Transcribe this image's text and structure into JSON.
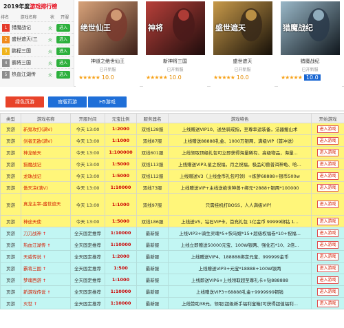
{
  "ranking": {
    "title_year": "2019年度",
    "title_hl": "游戏排行榜",
    "head": [
      "排名",
      "游戏名称",
      "状",
      "开服"
    ],
    "items": [
      {
        "num": "1",
        "name": "猎魔战记",
        "status": "火",
        "btn": "进入",
        "color": "#e53a2a"
      },
      {
        "num": "2",
        "name": "盛世遮天(三",
        "status": "火",
        "btn": "进入",
        "color": "#f08a1c"
      },
      {
        "num": "3",
        "name": "鹏程三国",
        "status": "火",
        "btn": "进入",
        "color": "#f0b41c"
      },
      {
        "num": "4",
        "name": "霸将三国",
        "status": "火",
        "btn": "进入",
        "color": "#8c8c8c"
      },
      {
        "num": "5",
        "name": "热血江湖传",
        "status": "火",
        "btn": "进入",
        "color": "#8c8c8c"
      }
    ]
  },
  "games": [
    {
      "name": "神道之绝世仙王",
      "status": "已开新服",
      "stars": "★★★★★",
      "score": "10.0",
      "active": false,
      "art": "绝世仙王"
    },
    {
      "name": "新神将三国",
      "status": "已开新服",
      "stars": "★★★★★",
      "score": "10.0",
      "active": false,
      "art": "神将"
    },
    {
      "name": "盛世遮天",
      "status": "已开新服",
      "stars": "★★★★★",
      "score": "10.0",
      "active": false,
      "art": "盛世遮天"
    },
    {
      "name": "猎魔战纪",
      "status": "已开新服",
      "stars": "★★★★★",
      "score": "10.0",
      "active": true,
      "art": "猎魔战纪"
    }
  ],
  "tabs": [
    {
      "label": "绿色页游",
      "color": "#e8432a"
    },
    {
      "label": "官版页游",
      "color": "#1f6fd8"
    },
    {
      "label": "H5游戏",
      "color": "#1f6fd8"
    }
  ],
  "table": {
    "headers": [
      "类型",
      "游戏名称",
      "开服时间",
      "元宝比例",
      "服务器名",
      "游戏特色",
      "开始游戏"
    ],
    "rows": [
      {
        "style": "y",
        "type": "页游",
        "name": "新鬼攻打(满V)",
        "hot": false,
        "time": "今天 13:00",
        "ratio": "1:2000",
        "server": "双线128服",
        "feature": "上线赠送VIP10、送坐骑戒指，至尊幸运装备，法器搬山术",
        "btn": "进入游戏"
      },
      {
        "style": "y",
        "type": "页游",
        "name": "剑者无敌(满V)",
        "hot": false,
        "time": "今天 13:00",
        "ratio": "1:1000",
        "server": "双线87服",
        "feature": "上线赠送88888礼金、1000万银两，满级VIP（首冲送）",
        "btn": "进入游戏"
      },
      {
        "style": "y",
        "type": "页游",
        "name": "神龙破天",
        "hot": false,
        "time": "今天 13:00",
        "ratio": "1:100000",
        "server": "双线601服",
        "feature": "上线领取顶级礼包可立即获得海量稀有、高级物品，海量...",
        "btn": "进入游戏"
      },
      {
        "style": "y",
        "type": "页游",
        "name": "猎魔战记",
        "hot": false,
        "time": "今天 13:00",
        "ratio": "1:5000",
        "server": "双线113服",
        "feature": "上线赠送VIP3,星之祝福，月之祝福，极品幻兽普洱神龟、哈...",
        "btn": "进入游戏"
      },
      {
        "style": "y",
        "type": "页游",
        "name": "龙珠战记",
        "hot": false,
        "time": "今天 13:00",
        "ratio": "1:5000",
        "server": "双线112服",
        "feature": "上线赠送V3（上线金币礼包可领）+炼萝68888+银币500w",
        "btn": "进入游戏"
      },
      {
        "style": "y",
        "type": "页游",
        "name": "傲天决(满V)",
        "hot": false,
        "time": "今天 13:00",
        "ratio": "1:10000",
        "server": "双线73服",
        "feature": "上线赠送VIP+主线送绝世神兽+绑元*2888+银两*100000",
        "btn": "进入游戏"
      },
      {
        "style": "y",
        "type": "页游",
        "name": "真龙主宰-盛世遮天",
        "hot": false,
        "time": "今天 13:00",
        "ratio": "1:1000",
        "server": "双线97服",
        "feature": "只需挂机打BOSS，人人满级VIP！",
        "btn": "进入游戏",
        "tall": true
      },
      {
        "style": "y",
        "type": "页游",
        "name": "神途天使",
        "hot": false,
        "time": "今天 13:00",
        "ratio": "1:5000",
        "server": "双线186服",
        "feature": "上线送V5，钻石VIP卡，首充礼包 1亿金币 99999绑钻 1...",
        "btn": "进入游戏"
      },
      {
        "style": "c",
        "type": "页游",
        "name": "刀刀战神",
        "hot": true,
        "time": "全天固定推荐",
        "ratio": "1:10000",
        "server": "最新服",
        "feature": "上线VIP3+骑生灵魂*5+快马嫂*15+超级权福卷*10+祝福...",
        "btn": "进入游戏"
      },
      {
        "style": "c",
        "type": "页游",
        "name": "热血江湖传",
        "hot": true,
        "time": "全天固定推荐",
        "ratio": "1:10000",
        "server": "最新服",
        "feature": "上线立即赠送50000元宝、100W银两、强化石*10、2倍...",
        "btn": "进入游戏"
      },
      {
        "style": "c",
        "type": "页游",
        "name": "天威传说",
        "hot": true,
        "time": "全天固定推荐",
        "ratio": "1:2000",
        "server": "最新服",
        "feature": "上线赠送VIP4、188888绑定元宝、999999金币",
        "btn": "进入游戏"
      },
      {
        "style": "c",
        "type": "页游",
        "name": "霸将三国",
        "hot": true,
        "time": "全天固定推荐",
        "ratio": "1:500",
        "server": "最新服",
        "feature": "上线赠送VIP3+元宝*18888+100W银两",
        "btn": "进入游戏"
      },
      {
        "style": "c",
        "type": "页游",
        "name": "梦魂西游",
        "hot": true,
        "time": "全天固定推荐",
        "ratio": "1:1000",
        "server": "最新服",
        "feature": "上线即送VIP6+上线领取超至尊礼卡+钻888888",
        "btn": "进入游戏"
      },
      {
        "style": "c",
        "type": "页游",
        "name": "新游戏传说",
        "hot": true,
        "time": "全天固定推荐",
        "ratio": "1:10000",
        "server": "最新服",
        "feature": "上线赠送VIP3+68888礼金+9999999铜钱",
        "btn": "进入游戏"
      },
      {
        "style": "c",
        "type": "页游",
        "name": "灭世",
        "hot": true,
        "time": "全天固定推荐",
        "ratio": "1:10000",
        "server": "最新服",
        "feature": "上线赞助38元，领取[超级新手福利宝箱]可获得超值福利...",
        "btn": "进入游戏"
      }
    ]
  }
}
